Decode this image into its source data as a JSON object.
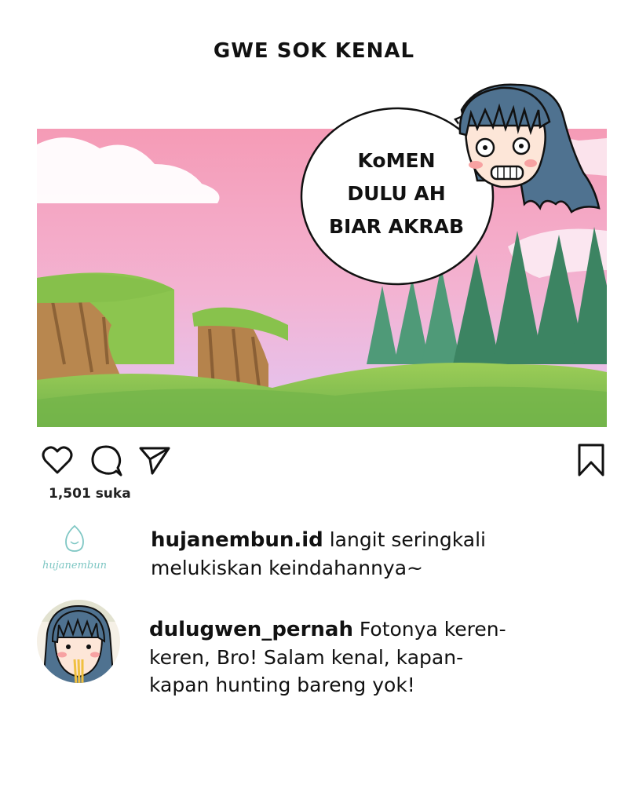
{
  "title": "GWE SOK KENAL",
  "speech_bubble": {
    "lines": [
      "KoMEN",
      "DULU AH",
      "BIAR AKRAB"
    ]
  },
  "post": {
    "likes": "1,501 suka",
    "icons": [
      "heart-icon",
      "comment-icon",
      "share-icon",
      "bookmark-icon"
    ]
  },
  "comments": [
    {
      "username": "hujanembun.id",
      "text": "langit seringkali melukiskan keindahannya~",
      "avatar_logo": "hujanembun"
    },
    {
      "username": "dulugwen_pernah",
      "text": "Fotonya keren-keren, Bro! Salam kenal, kapan-kapan hunting bareng yok!"
    }
  ],
  "colors": {
    "sky_pink": "#f4a7bf",
    "sky_lilac": "#e4c2f0",
    "grass": "#7fbf4c",
    "tree": "#3f8f6a",
    "hair": "#4d6f8c"
  }
}
